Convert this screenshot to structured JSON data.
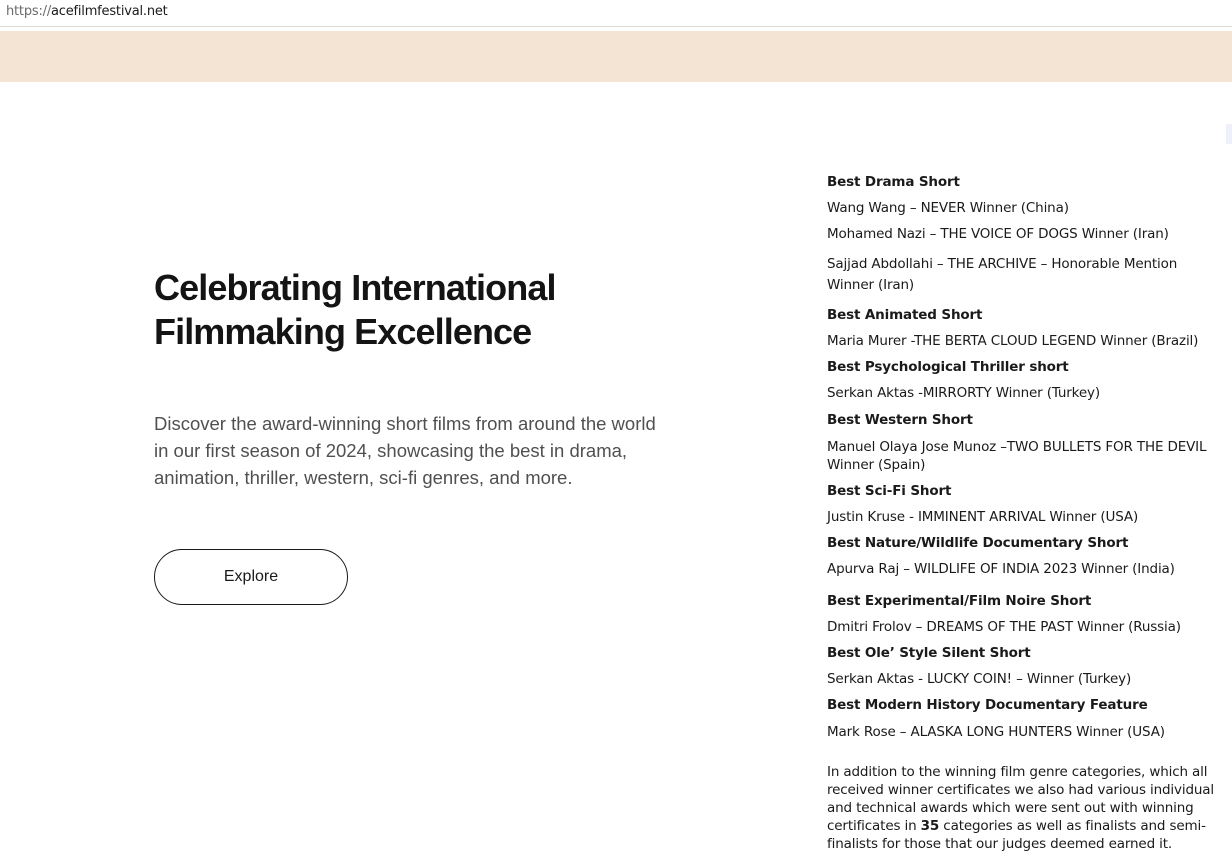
{
  "browser": {
    "url_scheme": "https://",
    "url_host": "acefilmfestival.net"
  },
  "header": {
    "band_color": "#f3e4d4"
  },
  "hero": {
    "title": "Celebrating International Filmmaking Excellence",
    "description": "Discover the award-winning short films from around the world in our first season of 2024, showcasing the best in drama, animation, thriller, western, sci-fi genres, and more.",
    "cta_label": "Explore"
  },
  "awards": [
    {
      "category": "Best Drama Short",
      "winners": [
        "Wang Wang – NEVER Winner (China)",
        "Mohamed Nazi – THE VOICE OF DOGS Winner (Iran)",
        "Sajjad Abdollahi – THE ARCHIVE – Honorable Mention Winner (Iran)"
      ]
    },
    {
      "category": "Best Animated Short",
      "winners": [
        "Maria Murer -THE BERTA CLOUD LEGEND Winner (Brazil)"
      ]
    },
    {
      "category": "Best Psychological Thriller short",
      "winners": [
        "Serkan Aktas -MIRRORTY Winner (Turkey)"
      ]
    },
    {
      "category": "Best Western Short",
      "winners": [
        "Manuel Olaya Jose Munoz –TWO BULLETS FOR THE DEVIL Winner (Spain)"
      ]
    },
    {
      "category": "Best Sci-Fi Short",
      "winners": [
        "Justin Kruse - IMMINENT ARRIVAL Winner (USA)"
      ]
    },
    {
      "category": "Best Nature/Wildlife Documentary Short",
      "winners": [
        "Apurva Raj – WILDLIFE OF INDIA 2023 Winner (India)"
      ]
    },
    {
      "category": "Best Experimental/Film Noire Short",
      "winners": [
        "Dmitri Frolov – DREAMS OF THE PAST Winner (Russia)"
      ]
    },
    {
      "category": "Best Ole’ Style Silent Short",
      "winners": [
        "Serkan Aktas - LUCKY COIN! – Winner (Turkey)"
      ]
    },
    {
      "category": "Best Modern History Documentary Feature",
      "winners": [
        "Mark Rose – ALASKA LONG HUNTERS Winner (USA)"
      ]
    }
  ],
  "note": {
    "before": "In addition to the winning film genre categories, which all received winner certificates we also had various individual and technical awards which were sent out with winning certificates in ",
    "count": "35",
    "after": " categories as well as finalists and semi-finalists for those that our judges deemed earned it."
  }
}
